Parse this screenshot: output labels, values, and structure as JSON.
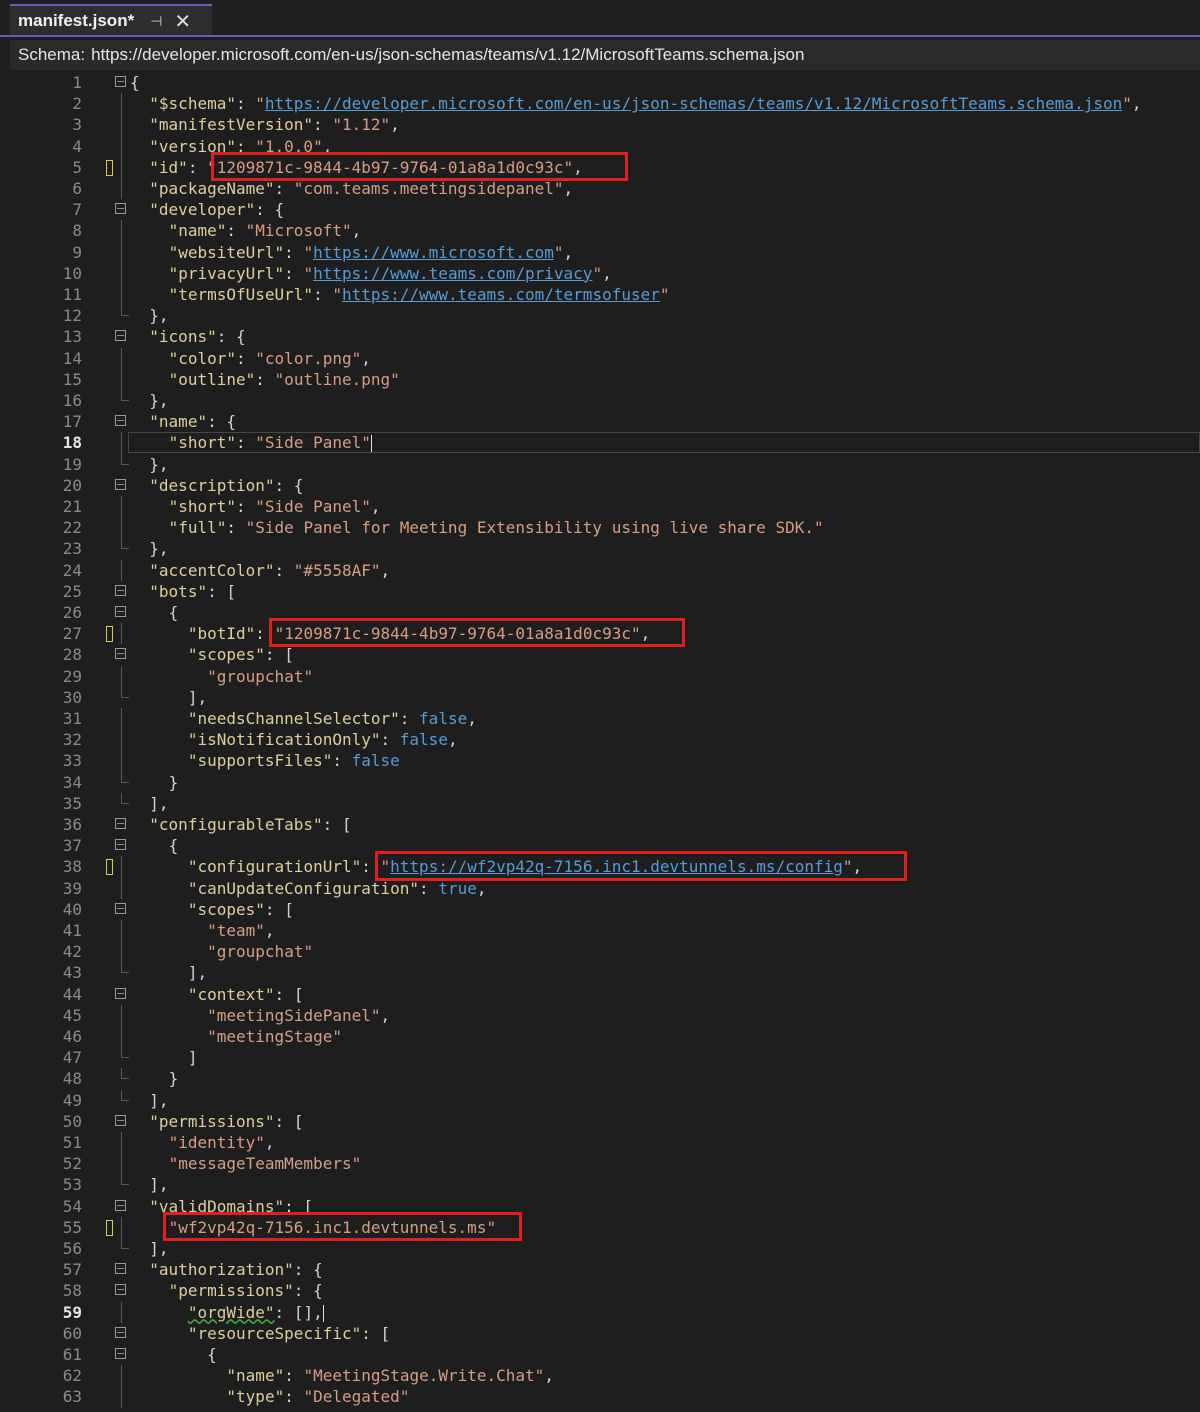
{
  "tab": {
    "title": "manifest.json*",
    "pin_icon": "pin-icon",
    "close_icon": "close-icon"
  },
  "schema": {
    "label": "Schema:",
    "url": "https://developer.microsoft.com/en-us/json-schemas/teams/v1.12/MicrosoftTeams.schema.json"
  },
  "active_line": 59,
  "lines": [
    [
      "{"
    ],
    [
      "  \"$schema\": \"https://developer.microsoft.com/en-us/json-schemas/teams/v1.12/MicrosoftTeams.schema.json\","
    ],
    [
      "  \"manifestVersion\": \"1.12\","
    ],
    [
      "  \"version\": \"1.0.0\","
    ],
    [
      "  \"id\": \"1209871c-9844-4b97-9764-01a8a1d0c93c\","
    ],
    [
      "  \"packageName\": \"com.teams.meetingsidepanel\","
    ],
    [
      "  \"developer\": {"
    ],
    [
      "    \"name\": \"Microsoft\","
    ],
    [
      "    \"websiteUrl\": \"https://www.microsoft.com\","
    ],
    [
      "    \"privacyUrl\": \"https://www.teams.com/privacy\","
    ],
    [
      "    \"termsOfUseUrl\": \"https://www.teams.com/termsofuser\""
    ],
    [
      "  },"
    ],
    [
      "  \"icons\": {"
    ],
    [
      "    \"color\": \"color.png\","
    ],
    [
      "    \"outline\": \"outline.png\""
    ],
    [
      "  },"
    ],
    [
      "  \"name\": {"
    ],
    [
      "    \"short\": \"Side Panel\""
    ],
    [
      "  },"
    ],
    [
      "  \"description\": {"
    ],
    [
      "    \"short\": \"Side Panel\","
    ],
    [
      "    \"full\": \"Side Panel for Meeting Extensibility using live share SDK.\""
    ],
    [
      "  },"
    ],
    [
      "  \"accentColor\": \"#5558AF\","
    ],
    [
      "  \"bots\": ["
    ],
    [
      "    {"
    ],
    [
      "      \"botId\": \"1209871c-9844-4b97-9764-01a8a1d0c93c\","
    ],
    [
      "      \"scopes\": ["
    ],
    [
      "        \"groupchat\""
    ],
    [
      "      ],"
    ],
    [
      "      \"needsChannelSelector\": false,"
    ],
    [
      "      \"isNotificationOnly\": false,"
    ],
    [
      "      \"supportsFiles\": false"
    ],
    [
      "    }"
    ],
    [
      "  ],"
    ],
    [
      "  \"configurableTabs\": ["
    ],
    [
      "    {"
    ],
    [
      "      \"configurationUrl\": \"https://wf2vp42q-7156.inc1.devtunnels.ms/config\","
    ],
    [
      "      \"canUpdateConfiguration\": true,"
    ],
    [
      "      \"scopes\": ["
    ],
    [
      "        \"team\","
    ],
    [
      "        \"groupchat\""
    ],
    [
      "      ],"
    ],
    [
      "      \"context\": ["
    ],
    [
      "        \"meetingSidePanel\","
    ],
    [
      "        \"meetingStage\""
    ],
    [
      "      ]"
    ],
    [
      "    }"
    ],
    [
      "  ],"
    ],
    [
      "  \"permissions\": ["
    ],
    [
      "    \"identity\","
    ],
    [
      "    \"messageTeamMembers\""
    ],
    [
      "  ],"
    ],
    [
      "  \"validDomains\": ["
    ],
    [
      "    \"wf2vp42q-7156.inc1.devtunnels.ms\""
    ],
    [
      "  ],"
    ],
    [
      "  \"authorization\": {"
    ],
    [
      "    \"permissions\": {"
    ],
    [
      "      \"orgWide\": [],"
    ],
    [
      "      \"resourceSpecific\": ["
    ],
    [
      "        {"
    ],
    [
      "          \"name\": \"MeetingStage.Write.Chat\","
    ],
    [
      "          \"type\": \"Delegated\""
    ]
  ]
}
